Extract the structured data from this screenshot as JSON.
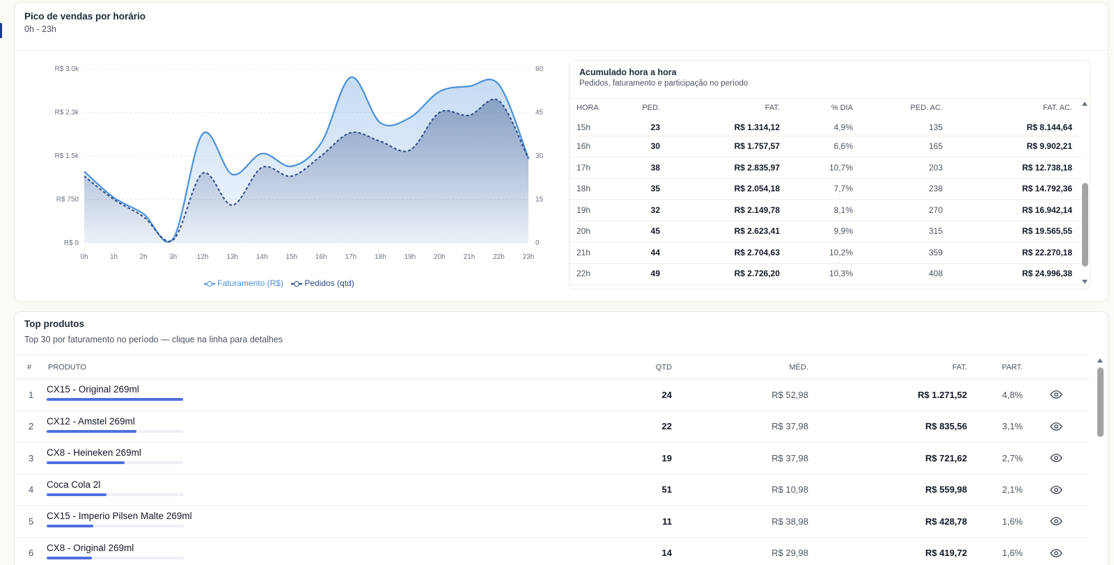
{
  "peak_card": {
    "title": "Pico de vendas por horário",
    "subtitle": "0h - 23h"
  },
  "chart_data": {
    "type": "area",
    "x": [
      "0h",
      "1h",
      "2h",
      "3h",
      "12h",
      "13h",
      "14h",
      "15h",
      "16h",
      "17h",
      "18h",
      "19h",
      "20h",
      "21h",
      "22h",
      "23h"
    ],
    "series": [
      {
        "name": "Faturamento (R$)",
        "axis": "left",
        "color": "#4a90d9",
        "values": [
          1230,
          780,
          500,
          70,
          1880,
          1180,
          1540,
          1320,
          1720,
          2855,
          2070,
          2160,
          2610,
          2700,
          2730,
          1460
        ]
      },
      {
        "name": "Pedidos (qtd)",
        "axis": "right",
        "color": "#2c4a85",
        "values": [
          23,
          15,
          9,
          1,
          24,
          13,
          26,
          23,
          30,
          38,
          35,
          32,
          45,
          44,
          49,
          29
        ]
      }
    ],
    "y_left": {
      "ticks": [
        "R$ 0",
        "R$ 750",
        "R$ 1.5k",
        "R$ 2.3k",
        "R$ 3.0k"
      ],
      "range": [
        0,
        3000
      ]
    },
    "y_right": {
      "ticks": [
        "0",
        "15",
        "30",
        "45",
        "60"
      ],
      "range": [
        0,
        60
      ]
    },
    "grid": true,
    "legend_position": "bottom"
  },
  "legend": {
    "fat": "Faturamento (R$)",
    "ped": "Pedidos (qtd)"
  },
  "acc": {
    "title": "Acumulado hora a hora",
    "subtitle": "Pedidos, faturamento e participação no período",
    "headers": [
      "HORA",
      "PED.",
      "FAT.",
      "% DIA",
      "PED. AC.",
      "FAT. AC."
    ],
    "rows": [
      [
        "15h",
        "23",
        "R$ 1.314,12",
        "4,9%",
        "135",
        "R$ 8.144,64"
      ],
      [
        "16h",
        "30",
        "R$ 1.757,57",
        "6,6%",
        "165",
        "R$ 9.902,21"
      ],
      [
        "17h",
        "38",
        "R$ 2.835,97",
        "10,7%",
        "203",
        "R$ 12.738,18"
      ],
      [
        "18h",
        "35",
        "R$ 2.054,18",
        "7,7%",
        "238",
        "R$ 14.792,36"
      ],
      [
        "19h",
        "32",
        "R$ 2.149,78",
        "8,1%",
        "270",
        "R$ 16.942,14"
      ],
      [
        "20h",
        "45",
        "R$ 2.623,41",
        "9,9%",
        "315",
        "R$ 19.565,55"
      ],
      [
        "21h",
        "44",
        "R$ 2.704,63",
        "10,2%",
        "359",
        "R$ 22.270,18"
      ],
      [
        "22h",
        "49",
        "R$ 2.726,20",
        "10,3%",
        "408",
        "R$ 24.996,38"
      ]
    ]
  },
  "top": {
    "title": "Top produtos",
    "subtitle": "Top 30 por faturamento no período — clique na linha para detalhes",
    "headers": {
      "num": "#",
      "produto": "PRODUTO",
      "qtd": "QTD",
      "med": "MÉD.",
      "fat": "FAT.",
      "part": "PART."
    },
    "rows": [
      {
        "n": "1",
        "name": "CX15 - Original 269ml",
        "share": 1.0,
        "qtd": "24",
        "med": "R$ 52,98",
        "fat": "R$ 1.271,52",
        "part": "4,8%"
      },
      {
        "n": "2",
        "name": "CX12 - Amstel 269ml",
        "share": 0.66,
        "qtd": "22",
        "med": "R$ 37,98",
        "fat": "R$ 835,56",
        "part": "3,1%"
      },
      {
        "n": "3",
        "name": "CX8 - Heineken 269ml",
        "share": 0.57,
        "qtd": "19",
        "med": "R$ 37,98",
        "fat": "R$ 721,62",
        "part": "2,7%"
      },
      {
        "n": "4",
        "name": "Coca Cola 2l",
        "share": 0.44,
        "qtd": "51",
        "med": "R$ 10,98",
        "fat": "R$ 559,98",
        "part": "2,1%"
      },
      {
        "n": "5",
        "name": "CX15 - Imperio Pilsen Malte 269ml",
        "share": 0.34,
        "qtd": "11",
        "med": "R$ 38,98",
        "fat": "R$ 428,78",
        "part": "1,6%"
      },
      {
        "n": "6",
        "name": "CX8 - Original 269ml",
        "share": 0.33,
        "qtd": "14",
        "med": "R$ 29,98",
        "fat": "R$ 419,72",
        "part": "1,6%"
      }
    ]
  }
}
